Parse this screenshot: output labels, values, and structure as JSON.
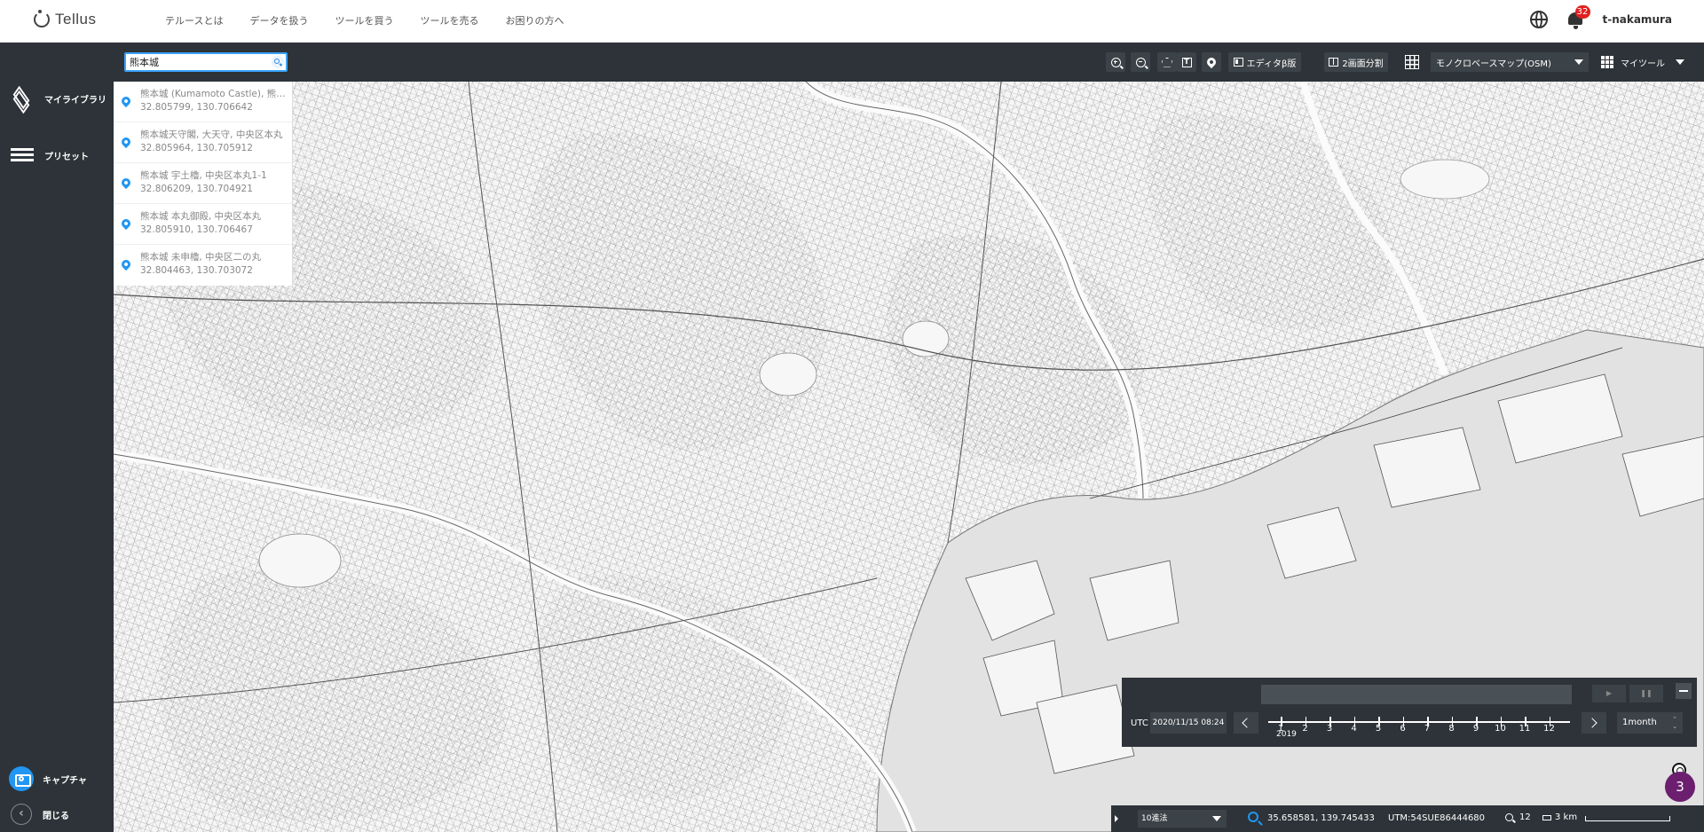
{
  "app": {
    "name": "Tellus"
  },
  "nav": {
    "links": [
      "テルースとは",
      "データを扱う",
      "ツールを買う",
      "ツールを売る",
      "お困りの方へ"
    ]
  },
  "header": {
    "notification_count": "32",
    "username": "t-nakamura",
    "globe_icon": "globe-icon",
    "bell_icon": "bell-icon"
  },
  "sidebar": {
    "items": [
      {
        "label": "マイライブラリ",
        "icon": "layers-icon"
      },
      {
        "label": "プリセット",
        "icon": "list-icon"
      }
    ],
    "capture_label": "キャプチャ",
    "close_label": "閉じる"
  },
  "search": {
    "value": "熊本城"
  },
  "toolbar": {
    "editor_label": "エディタβ版",
    "split_label": "2画面分割",
    "basemap": "モノクロベースマップ(OSM)",
    "mytool_label": "マイツール"
  },
  "results": [
    {
      "name": "熊本城 (Kumamoto Castle), 熊本城",
      "coord": "32.805799, 130.706642"
    },
    {
      "name": "熊本城天守閣, 大天守, 中央区本丸",
      "coord": "32.805964, 130.705912"
    },
    {
      "name": "熊本城 宇土櫓, 中央区本丸1-1",
      "coord": "32.806209, 130.704921"
    },
    {
      "name": "熊本城 本丸御殿, 中央区本丸",
      "coord": "32.805910, 130.706467"
    },
    {
      "name": "熊本城 未申櫓, 中央区二の丸",
      "coord": "32.804463, 130.703072"
    }
  ],
  "timepanel": {
    "utc_label": "UTC",
    "date": "2020/11/15 08:24",
    "months": [
      "1",
      "2",
      "3",
      "4",
      "5",
      "6",
      "7",
      "8",
      "9",
      "10",
      "11",
      "12"
    ],
    "year": "2019",
    "interval": "1month",
    "play_icon": "play-icon",
    "pause_icon": "pause-icon"
  },
  "statusbar": {
    "unit": "10進法",
    "coords": "35.658581, 139.745433",
    "utm": "UTM:54SUE86444680",
    "zoom": "12",
    "scale": "3 km"
  },
  "floating": {
    "badge": "3"
  },
  "colors": {
    "dark_panel": "#2d3338",
    "accent": "#2196f3",
    "badge": "#e02020",
    "float_badge": "#6b1f6e"
  }
}
